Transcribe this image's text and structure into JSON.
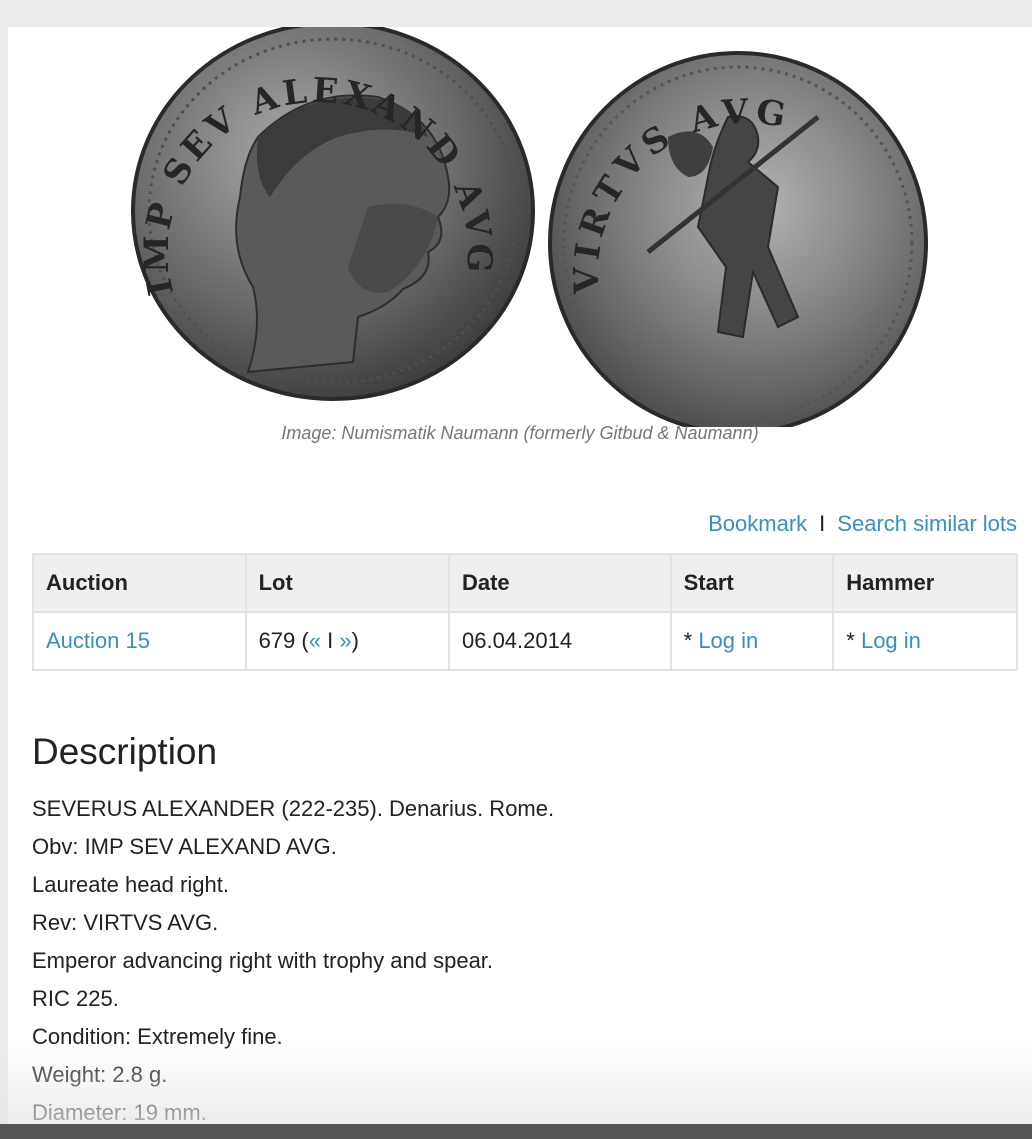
{
  "image": {
    "caption": "Image: Numismatik Naumann (formerly Gitbud & Naumann)",
    "obverse_legend": "IMP SEV ALEXAND AVG",
    "reverse_legend": "VIRTVS AVG"
  },
  "actions": {
    "bookmark": "Bookmark",
    "separator": "I",
    "search_similar": "Search similar lots"
  },
  "table": {
    "headers": [
      "Auction",
      "Lot",
      "Date",
      "Start",
      "Hammer"
    ],
    "row": {
      "auction": "Auction 15",
      "lot_number": "679 (",
      "prev": "«",
      "lot_sep": " I ",
      "next": "»",
      "lot_close": ")",
      "date": "06.04.2014",
      "start_prefix": "* ",
      "start_login": "Log in",
      "hammer_prefix": "* ",
      "hammer_login": "Log in"
    }
  },
  "description": {
    "title": "Description",
    "lines": [
      "SEVERUS ALEXANDER (222-235). Denarius. Rome.",
      "Obv: IMP SEV ALEXAND AVG.",
      "Laureate head right.",
      "Rev: VIRTVS AVG.",
      "Emperor advancing right with trophy and spear.",
      "RIC 225.",
      "Condition: Extremely fine.",
      "Weight: 2.8 g.",
      "Diameter: 19 mm."
    ]
  },
  "colors": {
    "link": "#3a8fc0",
    "header_bg": "#efefef",
    "border": "#e2e2e2",
    "caption": "#777777"
  }
}
